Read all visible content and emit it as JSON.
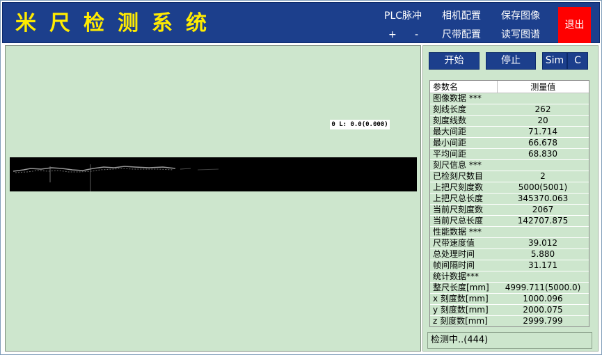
{
  "header": {
    "title": "米尺检测系统",
    "plc_pulse": "PLC脉冲",
    "plus": "+",
    "minus": "-",
    "camera_config": "相机配置",
    "tape_config": "尺带配置",
    "save_image": "保存图像",
    "rw_map": "读写图谱",
    "exit": "退出"
  },
  "image_view": {
    "measure_label": "0 L: 0.0(0.000)"
  },
  "controls": {
    "start": "开始",
    "stop": "停止",
    "sim": "Sim",
    "c": "C"
  },
  "param_table": {
    "col_name": "参数名",
    "col_value": "测量值",
    "rows": [
      {
        "name": "图像数据 ***",
        "value": ""
      },
      {
        "name": "刻线长度",
        "value": "262"
      },
      {
        "name": "刻度线数",
        "value": "20"
      },
      {
        "name": "最大间距",
        "value": "71.714"
      },
      {
        "name": "最小间距",
        "value": "66.678"
      },
      {
        "name": "平均间距",
        "value": "68.830"
      },
      {
        "name": "刻尺信息 ***",
        "value": ""
      },
      {
        "name": "已检刻尺数目",
        "value": "2"
      },
      {
        "name": "上把尺刻度数",
        "value": "5000(5001)"
      },
      {
        "name": "上把尺总长度",
        "value": "345370.063"
      },
      {
        "name": "当前尺刻度数",
        "value": "2067"
      },
      {
        "name": "当前尺总长度",
        "value": "142707.875"
      },
      {
        "name": "性能数据 ***",
        "value": ""
      },
      {
        "name": "尺带速度值",
        "value": "39.012"
      },
      {
        "name": "总处理时间",
        "value": "5.880"
      },
      {
        "name": "帧间隔时间",
        "value": "31.171"
      },
      {
        "name": "统计数据***",
        "value": ""
      },
      {
        "name": "整尺长度[mm]",
        "value": "4999.711(5000.0)"
      },
      {
        "name": "x 刻度数[mm]",
        "value": "1000.096"
      },
      {
        "name": "y 刻度数[mm]",
        "value": "2000.075"
      },
      {
        "name": "z 刻度数[mm]",
        "value": "2999.799"
      }
    ]
  },
  "status": {
    "text": "检测中..(444)"
  }
}
